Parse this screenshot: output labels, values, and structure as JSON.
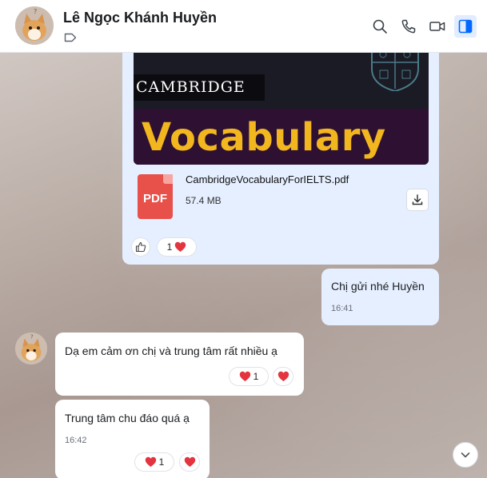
{
  "header": {
    "contact_name": "Lê Ngọc Khánh Huyền",
    "icons": [
      "tag-icon",
      "search-icon",
      "phone-icon",
      "video-call-icon",
      "side-panel-icon"
    ]
  },
  "file_message": {
    "banner_line1": "CAMBRIDGE",
    "banner_line2": "Vocabulary",
    "file_type": "PDF",
    "file_name": "CambridgeVocabularyForIELTS.pdf",
    "file_size": "57.4 MB",
    "reaction_count": "1"
  },
  "messages": [
    {
      "side": "me",
      "text": "Chị gửi nhé Huyền",
      "time": "16:41"
    },
    {
      "side": "them",
      "text": "Dạ em cảm ơn chị và trung tâm rất nhiều ạ",
      "reaction_count": "1"
    },
    {
      "side": "them",
      "text": "Trung tâm chu đáo quá ạ",
      "time": "16:42",
      "reaction_count": "1"
    }
  ],
  "colors": {
    "my_bubble": "#e5efff",
    "their_bubble": "#ffffff",
    "heart": "#e3343f",
    "pdf": "#e8504a",
    "banner_title": "#f2b61f"
  }
}
